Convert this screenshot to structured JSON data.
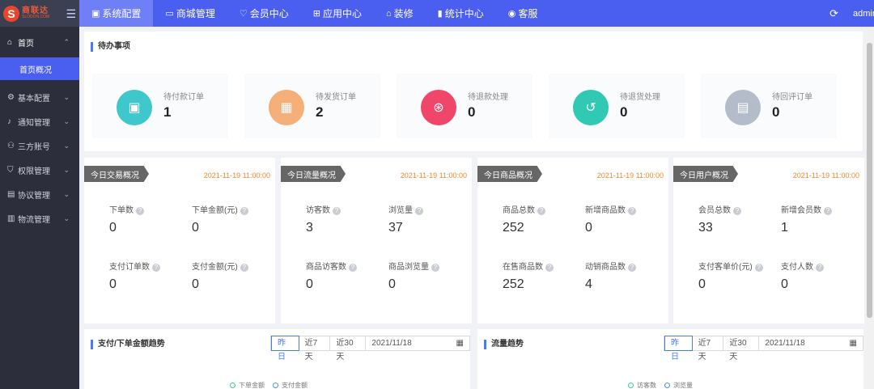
{
  "logo": {
    "mark": "S",
    "cn": "商联达",
    "en": "SLODON.COM"
  },
  "nav": [
    {
      "label": "系统配置",
      "icon": "▣"
    },
    {
      "label": "商城管理",
      "icon": "▭"
    },
    {
      "label": "会员中心",
      "icon": "♡"
    },
    {
      "label": "应用中心",
      "icon": "⊞"
    },
    {
      "label": "装修",
      "icon": "⌂"
    },
    {
      "label": "统计中心",
      "icon": "▮"
    },
    {
      "label": "客服",
      "icon": "◉"
    }
  ],
  "user": "admin",
  "sidebar": {
    "home": "首页",
    "home_sub": "首页概况",
    "items": [
      {
        "label": "基本配置",
        "icon": "⚙"
      },
      {
        "label": "通知管理",
        "icon": "♪"
      },
      {
        "label": "三方账号",
        "icon": "⚇"
      },
      {
        "label": "权限管理",
        "icon": "⛉"
      },
      {
        "label": "协议管理",
        "icon": "▤"
      },
      {
        "label": "物流管理",
        "icon": "▥"
      }
    ]
  },
  "todo": {
    "title": "待办事项",
    "cards": [
      {
        "label": "待付款订单",
        "value": "1",
        "color": "#3fc8cc",
        "icon": "▣"
      },
      {
        "label": "待发货订单",
        "value": "2",
        "color": "#f5b07a",
        "icon": "▦"
      },
      {
        "label": "待退款处理",
        "value": "0",
        "color": "#f0466a",
        "icon": "⊛"
      },
      {
        "label": "待退货处理",
        "value": "0",
        "color": "#30c9b4",
        "icon": "↺"
      },
      {
        "label": "待回评订单",
        "value": "0",
        "color": "#b4bcc9",
        "icon": "▤"
      }
    ]
  },
  "stats": [
    {
      "title": "今日交易概况",
      "date": "2021-11-19 11:00:00",
      "metrics": [
        {
          "label": "下单数",
          "value": "0"
        },
        {
          "label": "下单金额(元)",
          "value": "0"
        },
        {
          "label": "支付订单数",
          "value": "0"
        },
        {
          "label": "支付金额(元)",
          "value": "0"
        }
      ]
    },
    {
      "title": "今日流量概况",
      "date": "2021-11-19 11:00:00",
      "metrics": [
        {
          "label": "访客数",
          "value": "3"
        },
        {
          "label": "浏览量",
          "value": "37"
        },
        {
          "label": "商品访客数",
          "value": "0"
        },
        {
          "label": "商品浏览量",
          "value": "0"
        }
      ]
    },
    {
      "title": "今日商品概况",
      "date": "2021-11-19 11:00:00",
      "metrics": [
        {
          "label": "商品总数",
          "value": "252"
        },
        {
          "label": "新增商品数",
          "value": "0"
        },
        {
          "label": "在售商品数",
          "value": "252"
        },
        {
          "label": "动销商品数",
          "value": "4"
        }
      ]
    },
    {
      "title": "今日用户概况",
      "date": "2021-11-19 11:00:00",
      "metrics": [
        {
          "label": "会员总数",
          "value": "33"
        },
        {
          "label": "新增会员数",
          "value": "1"
        },
        {
          "label": "支付客单价(元)",
          "value": "0"
        },
        {
          "label": "支付人数",
          "value": "0"
        }
      ]
    }
  ],
  "trends": [
    {
      "title": "支付/下单金额趋势",
      "tabs": [
        "昨日",
        "近7天",
        "近30天"
      ],
      "date": "2021/11/18",
      "legend": [
        {
          "label": "下单金额",
          "color": "#3fc8a0"
        },
        {
          "label": "支付金额",
          "color": "#4a90e2"
        }
      ]
    },
    {
      "title": "流量趋势",
      "tabs": [
        "昨日",
        "近7天",
        "近30天"
      ],
      "date": "2021/11/18",
      "legend": [
        {
          "label": "访客数",
          "color": "#3fc8a0"
        },
        {
          "label": "浏览量",
          "color": "#4a90e2"
        }
      ]
    }
  ]
}
